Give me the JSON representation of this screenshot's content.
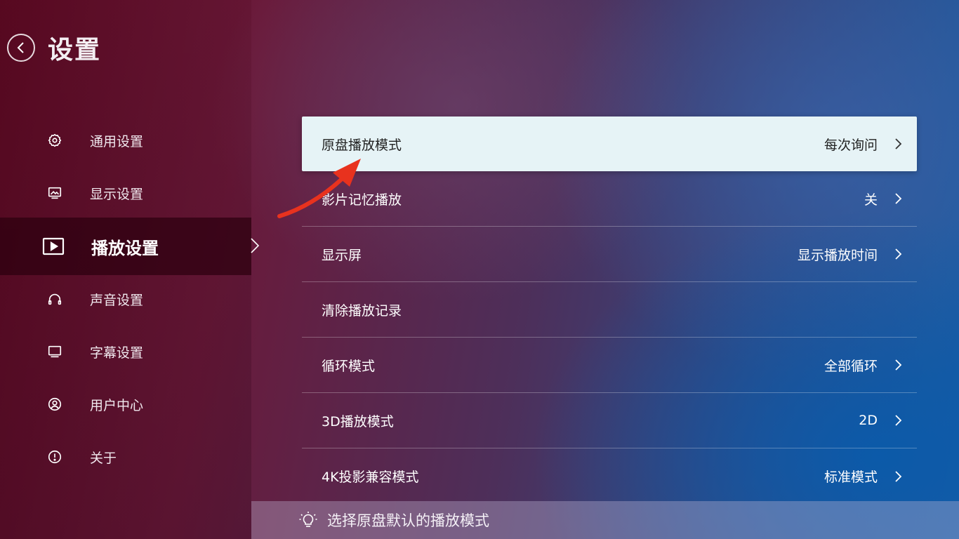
{
  "header": {
    "title": "设置",
    "back_icon": "chevron-left-icon"
  },
  "sidebar": {
    "items": [
      {
        "label": "通用设置",
        "icon": "gear-icon"
      },
      {
        "label": "显示设置",
        "icon": "image-icon"
      },
      {
        "label": "播放设置",
        "icon": "play-icon",
        "active": true
      },
      {
        "label": "声音设置",
        "icon": "headphones-icon"
      },
      {
        "label": "字幕设置",
        "icon": "monitor-icon"
      },
      {
        "label": "用户中心",
        "icon": "user-icon"
      },
      {
        "label": "关于",
        "icon": "info-icon"
      }
    ]
  },
  "settings": {
    "rows": [
      {
        "label": "原盘播放模式",
        "value": "每次询问",
        "focused": true
      },
      {
        "label": "影片记忆播放",
        "value": "关"
      },
      {
        "label": "显示屏",
        "value": "显示播放时间"
      },
      {
        "label": "清除播放记录",
        "value": ""
      },
      {
        "label": "循环模式",
        "value": "全部循环"
      },
      {
        "label": "3D播放模式",
        "value": "2D"
      },
      {
        "label": "4K投影兼容模式",
        "value": "标准模式"
      }
    ]
  },
  "hint": {
    "text": "选择原盘默认的播放模式",
    "icon": "lightbulb-icon"
  },
  "colors": {
    "focus_bg": "#e6f3f6",
    "annotation_arrow": "#e8321e"
  }
}
